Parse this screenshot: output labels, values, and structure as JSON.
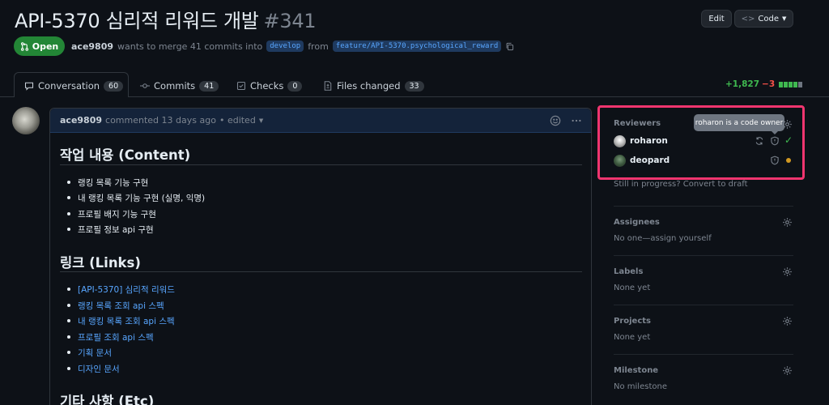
{
  "header": {
    "title": "API-5370 심리적 리워드 개발",
    "number": "#341",
    "edit_label": "Edit",
    "code_label": "Code"
  },
  "status": {
    "state": "Open",
    "author": "ace9809",
    "action_text": "wants to merge 41 commits into",
    "base_branch": "develop",
    "from_text": "from",
    "head_branch": "feature/API-5370.psychological_reward"
  },
  "tabs": [
    {
      "label": "Conversation",
      "count": "60",
      "icon": "comment-icon"
    },
    {
      "label": "Commits",
      "count": "41",
      "icon": "commit-icon"
    },
    {
      "label": "Checks",
      "count": "0",
      "icon": "checklist-icon"
    },
    {
      "label": "Files changed",
      "count": "33",
      "icon": "file-diff-icon"
    }
  ],
  "diffstat": {
    "additions": "+1,827",
    "deletions": "−3",
    "colors": [
      "#3fb950",
      "#3fb950",
      "#3fb950",
      "#3fb950",
      "#6e7681"
    ]
  },
  "comment": {
    "author": "ace9809",
    "meta": "commented 13 days ago",
    "edited": "• edited",
    "sections": [
      {
        "heading": "작업 내용 (Content)",
        "items": [
          "랭킹 목록 기능 구현",
          "내 랭킹 목록 기능 구현 (실명, 익명)",
          "프로필 배지 기능 구현",
          "프로필 정보 api 구현"
        ]
      },
      {
        "heading": "링크 (Links)",
        "links": [
          "[API-5370] 심리적 리워드",
          "랭킹 목록 조회 api 스펙",
          "내 랭킹 목록 조회 api 스펙",
          "프로필 조회 api 스펙",
          "기획 문서",
          "디자인 문서"
        ]
      },
      {
        "heading": "기타 사항 (Etc)"
      }
    ]
  },
  "sidebar": {
    "reviewers": {
      "heading": "Reviewers",
      "tooltip": "roharon is a code owner",
      "people": [
        {
          "name": "roharon",
          "status": "approved"
        },
        {
          "name": "deopard",
          "status": "pending"
        }
      ],
      "draft_hint": "Still in progress? Convert to draft"
    },
    "assignees": {
      "heading": "Assignees",
      "text": "No one—assign yourself"
    },
    "labels": {
      "heading": "Labels",
      "text": "None yet"
    },
    "projects": {
      "heading": "Projects",
      "text": "None yet"
    },
    "milestone": {
      "heading": "Milestone",
      "text": "No milestone"
    }
  },
  "colors": {
    "accent_highlight": "#f0356f",
    "open_green": "#238636",
    "link_blue": "#58a6ff"
  }
}
